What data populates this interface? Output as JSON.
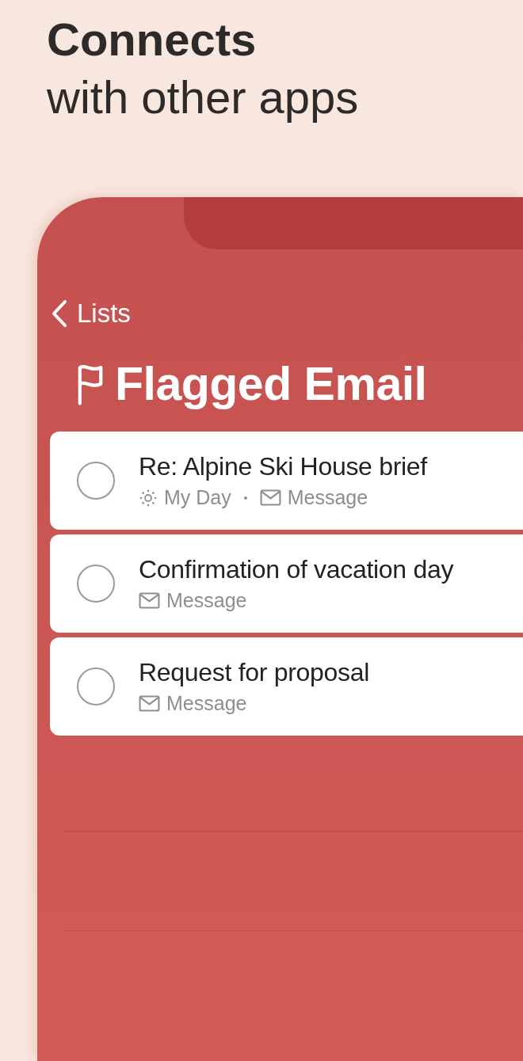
{
  "headline": {
    "title": "Connects",
    "subtitle": "with other apps"
  },
  "phone": {
    "back_link": "Lists",
    "list_title": "Flagged Email",
    "tasks": [
      {
        "title": "Re: Alpine Ski House brief",
        "completed": false,
        "tags": [
          {
            "kind": "my-day",
            "label": "My Day"
          },
          {
            "kind": "message",
            "label": "Message"
          }
        ]
      },
      {
        "title": "Confirmation of vacation day",
        "completed": false,
        "tags": [
          {
            "kind": "message",
            "label": "Message"
          }
        ]
      },
      {
        "title": "Request for proposal",
        "completed": false,
        "tags": [
          {
            "kind": "message",
            "label": "Message"
          }
        ]
      }
    ]
  }
}
